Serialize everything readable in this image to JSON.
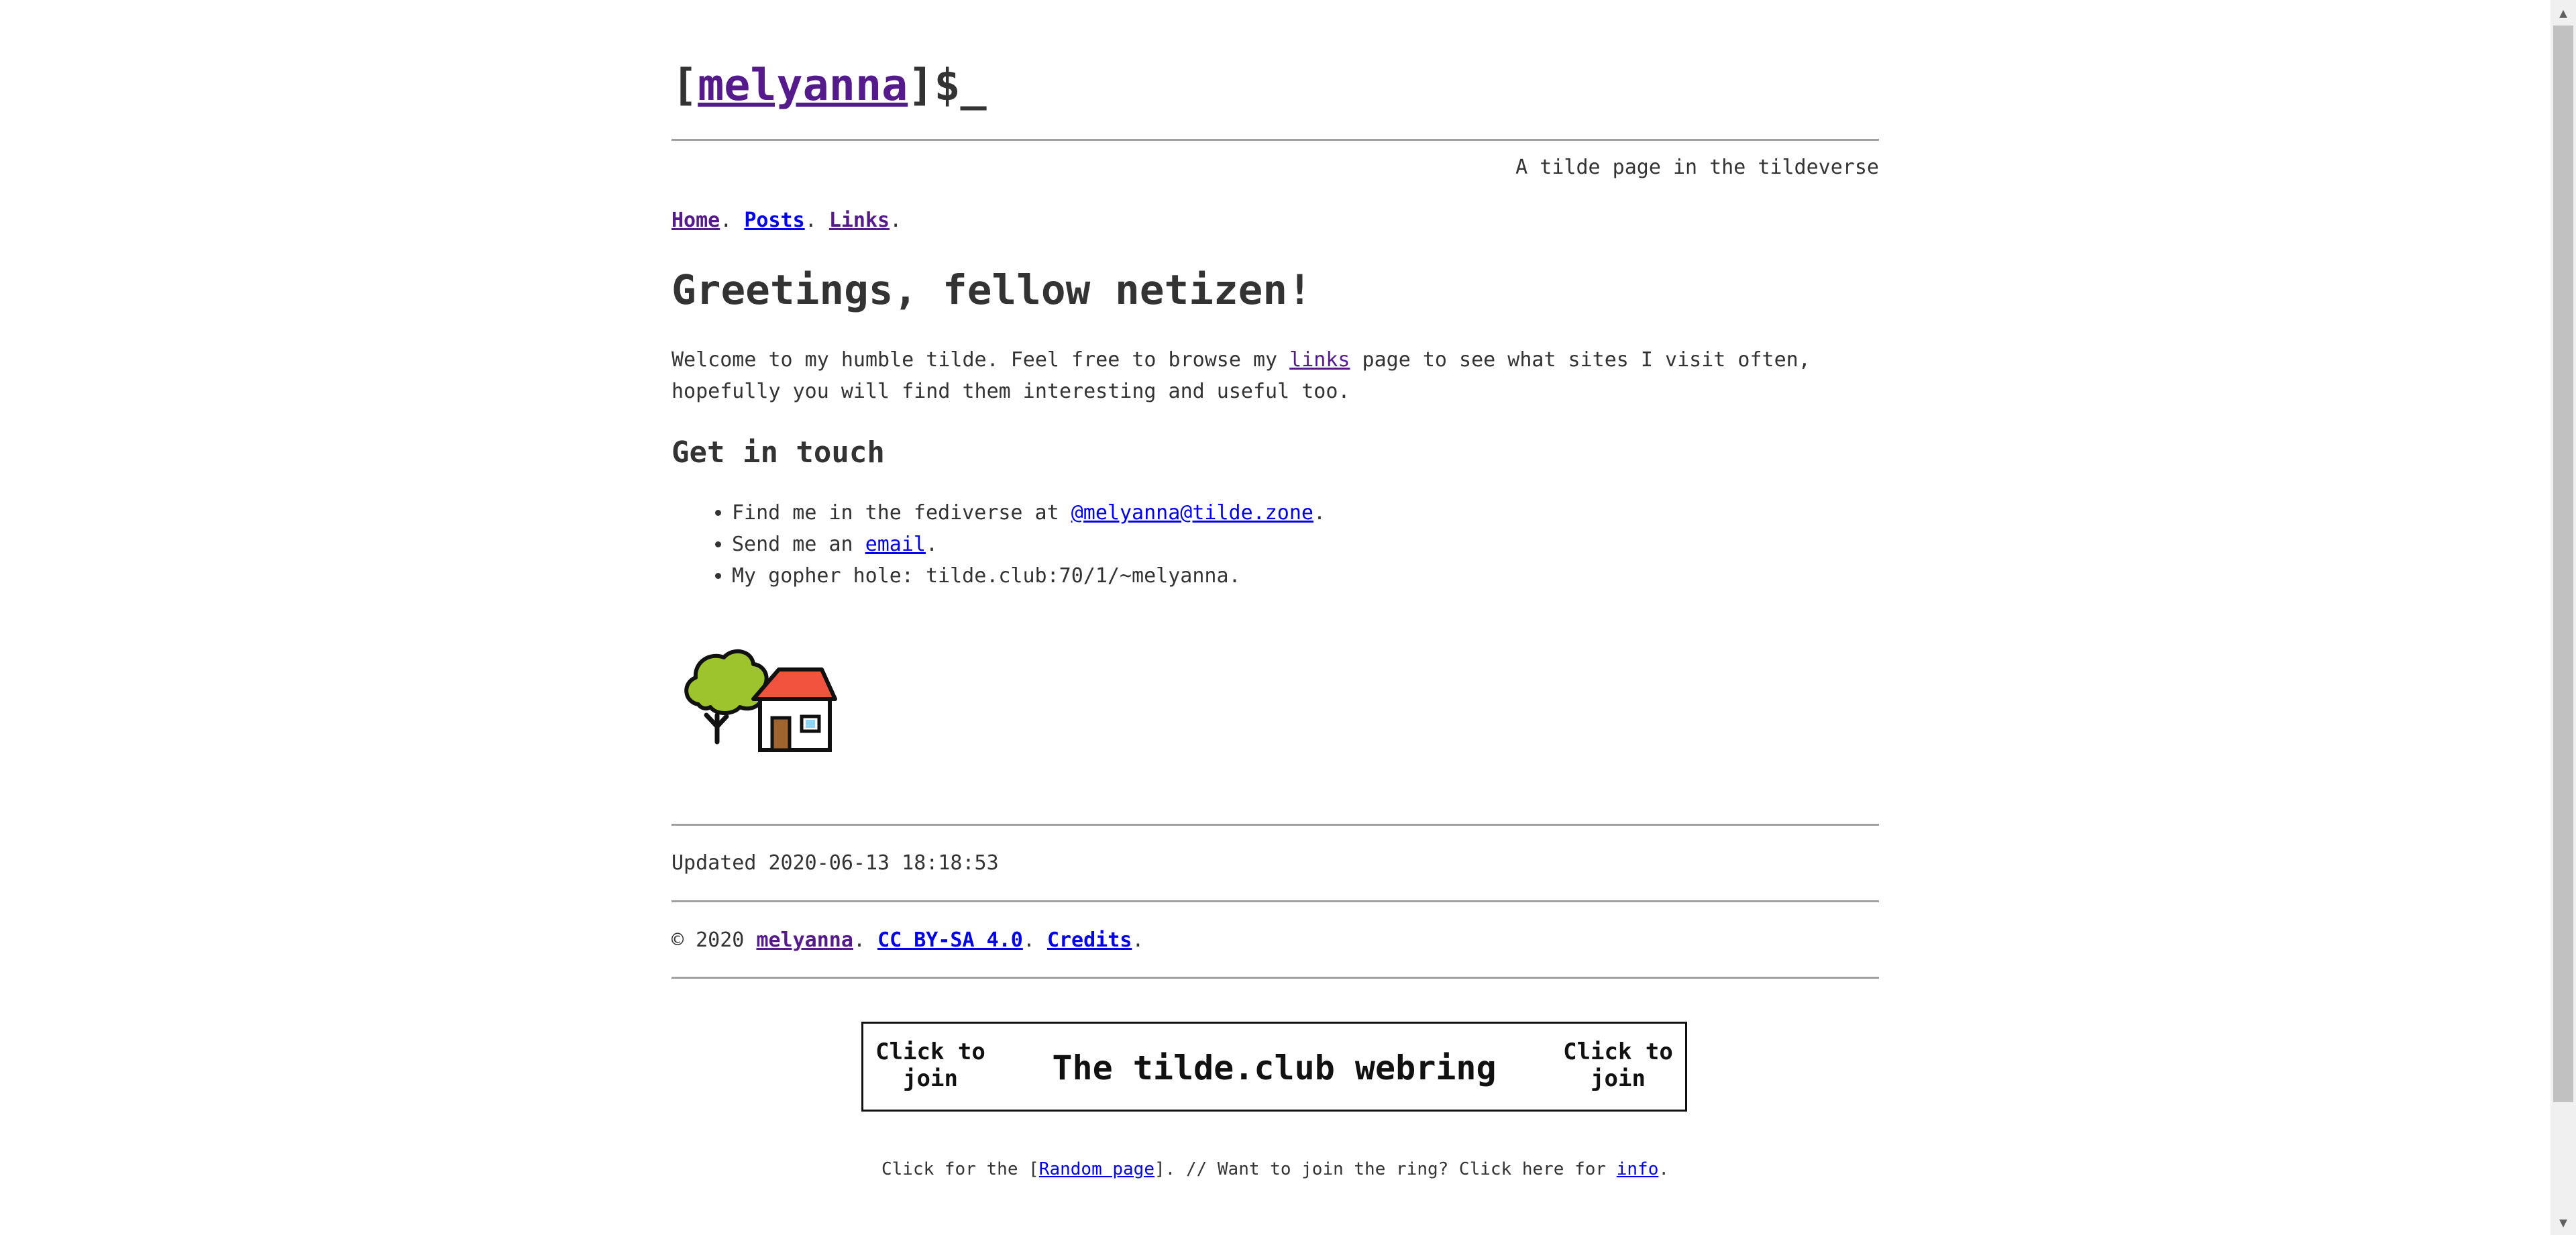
{
  "header": {
    "bracket_open": "[",
    "username": "melyanna",
    "prompt_suffix": "]$_",
    "tagline": "A tilde page in the tildeverse"
  },
  "nav": {
    "items": [
      {
        "label": "Home"
      },
      {
        "label": "Posts"
      },
      {
        "label": "Links"
      }
    ],
    "separator": "."
  },
  "main": {
    "heading": "Greetings, fellow netizen!",
    "intro_before": "Welcome to my humble tilde. Feel free to browse my ",
    "intro_link": "links",
    "intro_after": " page to see what sites I visit often, hopefully you will find them interesting and useful too.",
    "contact_heading": "Get in touch",
    "contact": {
      "fediverse_prefix": "Find me in the fediverse at ",
      "fediverse_handle": "@melyanna@tilde.zone",
      "fediverse_suffix": ".",
      "email_prefix": "Send me an ",
      "email_link": "email",
      "email_suffix": ".",
      "gopher": "My gopher hole: tilde.club:70/1/~melyanna."
    },
    "home_icon": "tree-and-house-icon"
  },
  "footer": {
    "updated": "Updated 2020-06-13 18:18:53",
    "copyright_prefix": "© 2020 ",
    "copyright_user": "melyanna",
    "license": "CC BY-SA 4.0",
    "credits": "Credits",
    "dot": "."
  },
  "webring": {
    "left_label": "Click to join",
    "title": "The tilde.club webring",
    "right_label": "Click to join",
    "note_prefix": "Click for the [",
    "random_link": "Random page",
    "note_middle": "]. // Want to join the ring? Click here for ",
    "info_link": "info",
    "note_suffix": "."
  },
  "colors": {
    "text": "#333333",
    "link": "#0000ee",
    "visited_link": "#551a8b",
    "rule": "#a0a0a0"
  }
}
